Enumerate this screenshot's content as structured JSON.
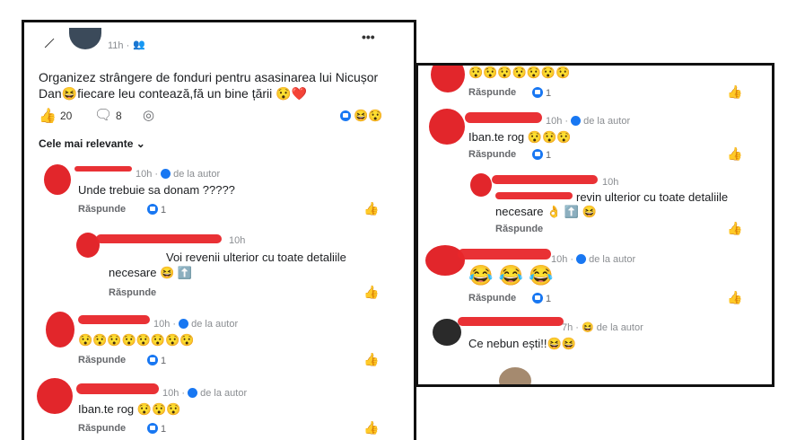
{
  "post": {
    "time": "11h · ",
    "text_line1": "Organizez strângere de fonduri pentru asasinarea lui Nicușor",
    "text_line2": "Dan",
    "text_line2b": "fiecare leu contează,fă un bine țării",
    "likes": "20",
    "comments": "8",
    "more": "•••",
    "filter": "Cele mai relevante"
  },
  "left_comments": [
    {
      "time": "10h · ",
      "author_tag": "de la autor",
      "text": "Unde trebuie sa donam ?????",
      "reply": "Răspunde",
      "reactions": "1"
    },
    {
      "time": "10h",
      "text_a": "Voi revenii ulterior cu toate detaliile",
      "text_b": "necesare",
      "reply": "Răspunde"
    },
    {
      "time": "10h · ",
      "author_tag": "de la autor",
      "emojis": "😯😯😯😯😯😯😯😯",
      "reply": "Răspunde",
      "reactions": "1"
    },
    {
      "time": "10h · ",
      "author_tag": "de la autor",
      "text": "Iban.te rog",
      "emojis": "😯😯😯",
      "reply": "Răspunde",
      "reactions": "1"
    }
  ],
  "right_comments": [
    {
      "emojis": "😯😯😯😯😯😯😯",
      "reply": "Răspunde",
      "reactions": "1"
    },
    {
      "time": "10h · ",
      "author_tag": "de la autor",
      "text": "Iban.te rog",
      "emojis": "😯😯😯",
      "reply": "Răspunde",
      "reactions": "1"
    },
    {
      "time": "10h",
      "text_a": "revin ulterior cu toate detaliile",
      "text_b": "necesare",
      "emojis": "😆",
      "reply": "Răspunde"
    },
    {
      "time": "10h · ",
      "author_tag": "de la autor",
      "emojis": "😂 😂 😂",
      "reply": "Răspunde",
      "reactions": "1"
    },
    {
      "time": "7h · ",
      "author_tag": "de la autor",
      "text": "Ce nebun ești!!",
      "emojis": "😆😆"
    }
  ],
  "colors": {
    "accent": "#1877f2",
    "scribble": "#e8262a"
  }
}
